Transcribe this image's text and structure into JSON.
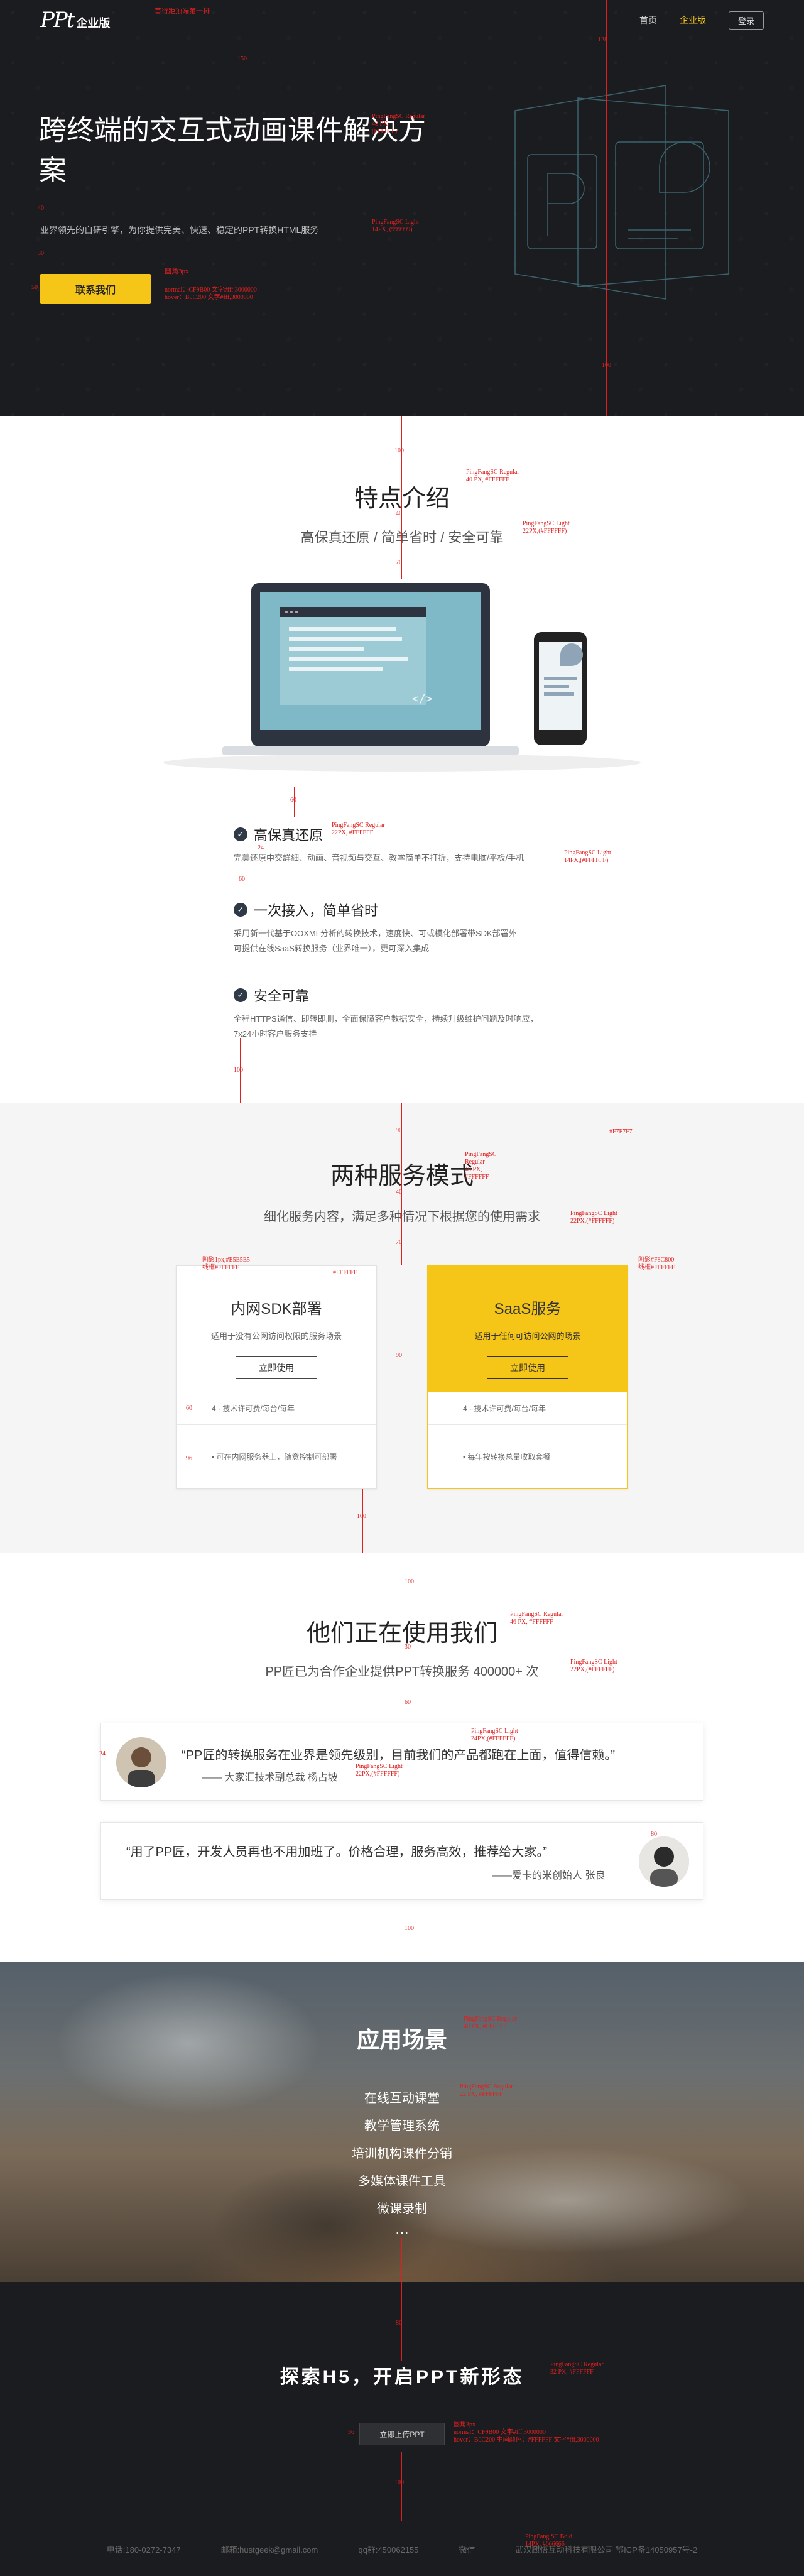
{
  "brand": {
    "logo": "PPt",
    "edition": "企业版",
    "annotation": "首行距顶端第一排"
  },
  "nav": {
    "home": "首页",
    "enterprise": "企业版",
    "login": "登录"
  },
  "hero": {
    "title": "跨终端的交互式动画课件解决方案",
    "subtitle": "业界领先的自研引擎，为你提供完美、快速、稳定的PPT转换HTML服务",
    "cta": "联系我们",
    "spec_title": "PingFangSC Regular\n48 PX\n(FFFFFF)",
    "spec_sub": "PingFangSC Light\n14PX, (999999)",
    "spec_btn_title": "圆角3px",
    "spec_btn": "normal：CF9B00 文字#fff,3000000\nhover：B0C200 文字#fff,3000000",
    "dim_128": "128",
    "dim_40": "40",
    "dim_30": "30",
    "dim_50": "50",
    "dim_100": "100",
    "dim_150": "150"
  },
  "features": {
    "title": "特点介绍",
    "subtitle": "高保真还原 / 简单省时 / 安全可靠",
    "spec_title": "PingFangSC Regular\n40 PX, #FFFFFF",
    "spec_sub": "PingFangSC Light\n22PX,(#FFFFFF)",
    "items": [
      {
        "title": "高保真还原",
        "desc": "完美还原中交詳細、动画、音视频与交互、教学简单不打折，支持电脑/平板/手机"
      },
      {
        "title": "一次接入，简单省时",
        "desc": "采用新一代基于OOXML分析的转换技术，速度快、可或模化部署带SDK部署外\n可提供在线SaaS转换服务（业界唯一），更可深入集成"
      },
      {
        "title": "安全可靠",
        "desc": "全程HTTPS通信、即转即删，全面保障客户数据安全，持续升级维护问题及时响应，\n7x24小时客户服务支持"
      }
    ],
    "spec_item_title": "PingFangSC Regular\n22PX, #FFFFFF",
    "spec_item_desc": "PingFangSC Light\n14PX,(#FFFFFF)",
    "dim_100": "100",
    "dim_40": "40",
    "dim_70": "70",
    "dim_60": "60",
    "dim_24": "24",
    "dim_30": "30"
  },
  "services": {
    "title": "两种服务模式",
    "subtitle": "细化服务内容，满足多种情况下根据您的使用需求",
    "spec_title": "PingFangSC\nRegular\n40 PX,\n#FFFFFF",
    "spec_sub": "PingFangSC Light\n22PX,(#FFFFFF)",
    "bg_note": "#F7F7F7",
    "card_note": "#FFFFFF",
    "card_shadow": "阴影1px,#E5E5E5\n线框#FFFFFF",
    "saas_shadow": "阴影#F8C800\n线框#FFFFFF",
    "cards": [
      {
        "title": "内网SDK部署",
        "desc": "适用于没有公网访问权限的服务场景",
        "button": "立即使用",
        "rows": [
          "4 · 技术许可费/每台/每年",
          "• 可在内网服务器上，随意控制可部署"
        ]
      },
      {
        "title": "SaaS服务",
        "desc": "适用于任何可访问公网的场景",
        "button": "立即使用",
        "rows": [
          "4 · 技术许可费/每台/每年",
          "• 每年按转换总量收取套餐"
        ]
      }
    ],
    "dim_90": "90",
    "dim_40": "40",
    "dim_70": "70",
    "dim_28": "28",
    "dim_60": "60",
    "dim_96": "96",
    "dim_100": "100"
  },
  "clients": {
    "title": "他们正在使用我们",
    "subtitle": "PP匠已为合作企业提供PPT转换服务 400000+ 次",
    "spec_title": "PingFangSC Regular\n46 PX, #FFFFFF",
    "spec_sub": "PingFangSC Light\n22PX,(#FFFFFF)",
    "testimonials": [
      {
        "quote": "“PP匠的转换服务在业界是领先级别，目前我们的产品都跑在上面，值得信赖。”",
        "author": "—— 大家汇技术副总裁 杨占坡"
      },
      {
        "quote": "“用了PP匠，开发人员再也不用加班了。价格合理，服务高效，推荐给大家。”",
        "author": "——爱卡的米创始人 张良"
      }
    ],
    "spec_quote": "PingFangSC Light\n24PX,(#FFFFFF)",
    "spec_author": "PingFangSC Light\n22PX,(#FFFFFF)",
    "dim_100": "100",
    "dim_60": "60",
    "dim_30": "30",
    "dim_24": "24",
    "dim_80": "80"
  },
  "scenes": {
    "title": "应用场景",
    "items": [
      "在线互动课堂",
      "教学管理系统",
      "培训机构课件分销",
      "多媒体课件工具",
      "微课录制"
    ],
    "more": "···",
    "spec_title": "PingFangSC Regular\n40 PX, #FFFFFF",
    "spec_items": "PingFangSC Regular\n22 PX, #FFFFFF"
  },
  "cta": {
    "title": "探索H5，开启PPT新形态",
    "button": "立即上传PPT",
    "spec_title": "PingFangSC Regular\n32 PX, #FFFFFF",
    "spec_btn": "圆角3px\nnormal：CF9B00 文字#fff,3000000\nhover：B0C200 中间颜色：#FFFFFF 文字#fff,3000000",
    "dim_80": "80",
    "dim_100": "100",
    "dim_36": "36"
  },
  "footer": {
    "phone": "电话:180-0272-7347",
    "email": "邮箱:hustgeek@gmail.com",
    "qq": "qq群:450062155",
    "wechat": "微信",
    "company": "武汉麒悟互动科技有限公司 鄂ICP备14050957号-2",
    "spec": "PingFang SC Bold\n14PX, #666666"
  }
}
